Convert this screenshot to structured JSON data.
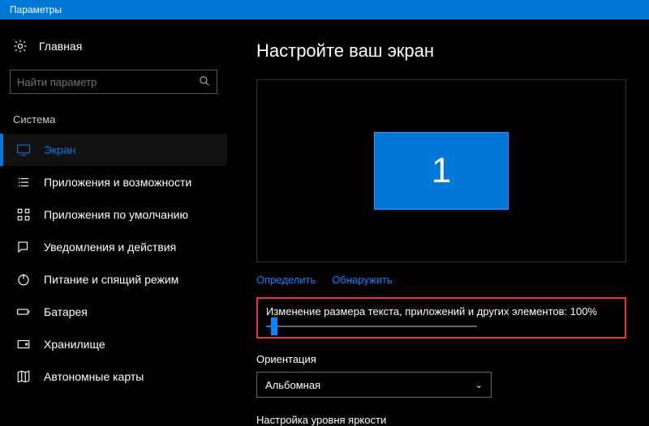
{
  "titlebar": {
    "title": "Параметры"
  },
  "sidebar": {
    "home_label": "Главная",
    "search_placeholder": "Найти параметр",
    "category": "Система",
    "items": [
      {
        "label": "Экран"
      },
      {
        "label": "Приложения и возможности"
      },
      {
        "label": "Приложения по умолчанию"
      },
      {
        "label": "Уведомления и действия"
      },
      {
        "label": "Питание и спящий режим"
      },
      {
        "label": "Батарея"
      },
      {
        "label": "Хранилище"
      },
      {
        "label": "Автономные карты"
      }
    ]
  },
  "main": {
    "title": "Настройте ваш экран",
    "monitor_number": "1",
    "links": {
      "identify": "Определить",
      "detect": "Обнаружить"
    },
    "scale_label": "Изменение размера текста, приложений и других элементов: 100%",
    "orientation_label": "Ориентация",
    "orientation_value": "Альбомная",
    "brightness_label": "Настройка уровня яркости"
  }
}
